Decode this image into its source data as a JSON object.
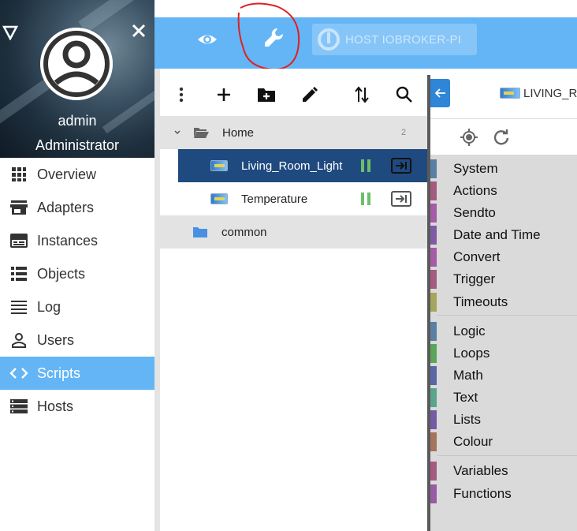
{
  "drawer": {
    "user_name": "admin",
    "user_role": "Administrator",
    "items": [
      {
        "label": "Overview",
        "icon": "grid-icon"
      },
      {
        "label": "Adapters",
        "icon": "store-icon"
      },
      {
        "label": "Instances",
        "icon": "instances-icon"
      },
      {
        "label": "Objects",
        "icon": "list-icon"
      },
      {
        "label": "Log",
        "icon": "lines-icon"
      },
      {
        "label": "Users",
        "icon": "person-icon"
      },
      {
        "label": "Scripts",
        "icon": "code-icon",
        "active": true
      },
      {
        "label": "Hosts",
        "icon": "server-icon"
      }
    ]
  },
  "appbar": {
    "host_label": "HOST IOBROKER-PI",
    "accent_color": "#64b5f6"
  },
  "tree": {
    "home": {
      "label": "Home",
      "count": "2"
    },
    "scripts": [
      {
        "label": "Living_Room_Light",
        "selected": true
      },
      {
        "label": "Temperature",
        "selected": false
      }
    ],
    "common": {
      "label": "common"
    }
  },
  "editor": {
    "tab_label": "LIVING_R"
  },
  "blockly": {
    "categories": [
      {
        "label": "System",
        "color": "#5b80a5"
      },
      {
        "label": "Actions",
        "color": "#a55b80"
      },
      {
        "label": "Sendto",
        "color": "#a55ba5"
      },
      {
        "label": "Date and Time",
        "color": "#805ba5"
      },
      {
        "label": "Convert",
        "color": "#a55ba5"
      },
      {
        "label": "Trigger",
        "color": "#a55b80"
      },
      {
        "label": "Timeouts",
        "color": "#a5a55b"
      },
      {
        "label": "Logic",
        "color": "#5b80a5"
      },
      {
        "label": "Loops",
        "color": "#5ba55b"
      },
      {
        "label": "Math",
        "color": "#5b67a5"
      },
      {
        "label": "Text",
        "color": "#5ba58c"
      },
      {
        "label": "Lists",
        "color": "#745ba5"
      },
      {
        "label": "Colour",
        "color": "#a5745b"
      },
      {
        "label": "Variables",
        "color": "#a55b80"
      },
      {
        "label": "Functions",
        "color": "#995ba5"
      }
    ]
  }
}
